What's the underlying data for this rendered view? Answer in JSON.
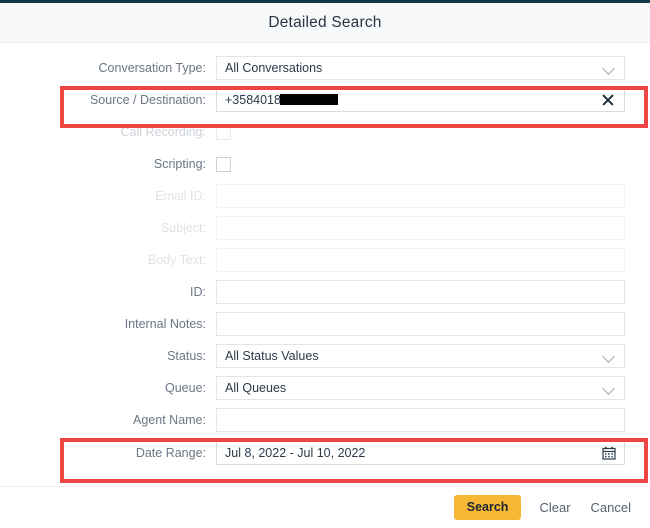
{
  "dialog": {
    "title": "Detailed Search"
  },
  "form": {
    "rows": [
      {
        "label": "Conversation Type:",
        "type": "select",
        "value": "All Conversations",
        "disabled": false
      },
      {
        "label": "Source / Destination:",
        "type": "text-clear",
        "value": "+3584018",
        "disabled": false
      },
      {
        "label": "Call Recording:",
        "type": "checkbox",
        "value": "",
        "disabled": true
      },
      {
        "label": "Scripting:",
        "type": "checkbox",
        "value": "",
        "disabled": false
      },
      {
        "label": "Email ID:",
        "type": "text",
        "value": "",
        "disabled": true
      },
      {
        "label": "Subject:",
        "type": "text",
        "value": "",
        "disabled": true
      },
      {
        "label": "Body Text:",
        "type": "text",
        "value": "",
        "disabled": true
      },
      {
        "label": "ID:",
        "type": "text",
        "value": "",
        "disabled": false
      },
      {
        "label": "Internal Notes:",
        "type": "text",
        "value": "",
        "disabled": false
      },
      {
        "label": "Status:",
        "type": "select",
        "value": "All Status Values",
        "disabled": false
      },
      {
        "label": "Queue:",
        "type": "select",
        "value": "All Queues",
        "disabled": false
      },
      {
        "label": "Agent Name:",
        "type": "text",
        "value": "",
        "disabled": false
      },
      {
        "label": "Date Range:",
        "type": "date",
        "value": "Jul 8, 2022 - Jul 10, 2022",
        "disabled": false
      }
    ]
  },
  "footer": {
    "search_label": "Search",
    "clear_label": "Clear",
    "cancel_label": "Cancel"
  },
  "colors": {
    "accent_button": "#f7b835",
    "annotation": "#ef4444",
    "top_strip": "#173a4a"
  }
}
